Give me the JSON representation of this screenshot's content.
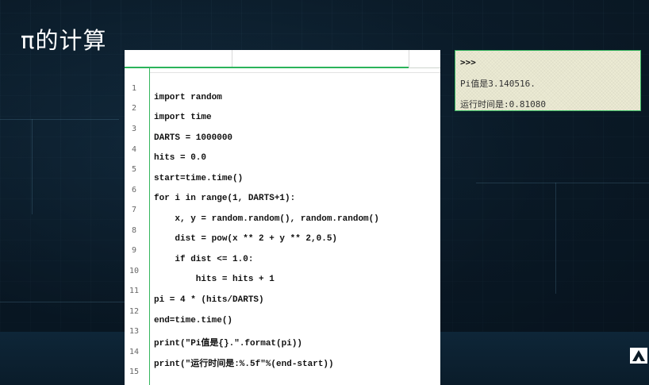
{
  "slide": {
    "title": "π的计算"
  },
  "editor": {
    "line_numbers": [
      "1",
      "2",
      "3",
      "4",
      "5",
      "6",
      "7",
      "8",
      "9",
      "10",
      "11",
      "12",
      "13",
      "14",
      "15"
    ],
    "code_lines": [
      "import random",
      "import time",
      "DARTS = 1000000",
      "hits = 0.0",
      "start=time.time()",
      "for i in range(1, DARTS+1):",
      "    x, y = random.random(), random.random()",
      "    dist = pow(x ** 2 + y ** 2,0.5)",
      "    if dist <= 1.0:",
      "        hits = hits + 1",
      "pi = 4 * (hits/DARTS)",
      "end=time.time()",
      "print(\"Pi值是{}.\".format(pi))",
      "print(\"运行时间是:%.5f\"%(end-start))"
    ]
  },
  "output": {
    "prompt": ">>>",
    "lines": [
      "Pi值是3.140516.",
      "运行时间是:0.81080"
    ]
  },
  "icons": {
    "logo": "logo-icon"
  },
  "colors": {
    "accent_green": "#34b65e",
    "output_bg": "#ecebd4",
    "background": "#0b1a26"
  }
}
